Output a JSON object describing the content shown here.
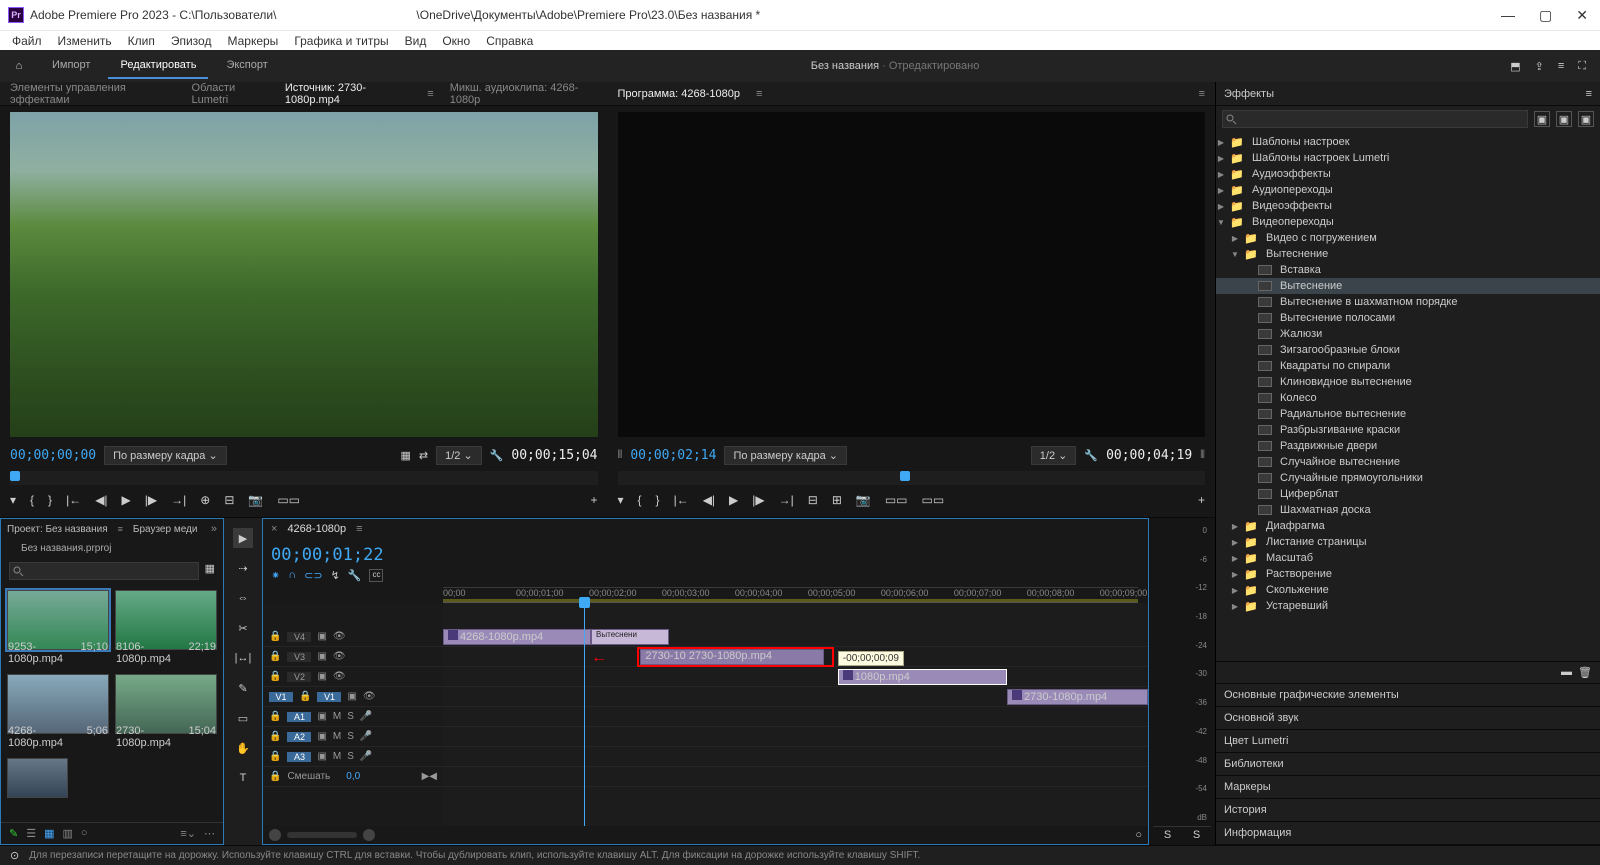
{
  "titlebar": {
    "app": "Adobe Premiere Pro 2023 - C:\\Пользователи\\",
    "path": "\\OneDrive\\Документы\\Adobe\\Premiere Pro\\23.0\\Без названия *"
  },
  "menubar": [
    "Файл",
    "Изменить",
    "Клип",
    "Эпизод",
    "Маркеры",
    "Графика и титры",
    "Вид",
    "Окно",
    "Справка"
  ],
  "header": {
    "workspaces": [
      "Импорт",
      "Редактировать",
      "Экспорт"
    ],
    "activeWs": 1,
    "docTitle": "Без названия",
    "docModified": "· Отредактировано"
  },
  "sourceTabs": {
    "items": [
      "Элементы управления эффектами",
      "Области Lumetri",
      "Источник: 2730-1080p.mp4",
      "Микш. аудиоклипа: 4268-1080p"
    ],
    "active": 2
  },
  "programTab": "Программа: 4268-1080p",
  "sourceMonitor": {
    "tcLeft": "00;00;00;00",
    "fit": "По размеру кадра",
    "res": "1/2",
    "tcRight": "00;00;15;04"
  },
  "programMonitor": {
    "tcLeft": "00;00;02;14",
    "fit": "По размеру кадра",
    "res": "1/2",
    "tcRight": "00;00;04;19"
  },
  "project": {
    "tab1": "Проект: Без названия",
    "tab2": "Браузер меди",
    "file": "Без названия.prproj",
    "clips": [
      {
        "name": "9253-1080p.mp4",
        "dur": "15;10"
      },
      {
        "name": "8106-1080p.mp4",
        "dur": "22;19"
      },
      {
        "name": "4268-1080p.mp4",
        "dur": "5;06"
      },
      {
        "name": "2730-1080p.mp4",
        "dur": "15;04"
      },
      {
        "name": "",
        "dur": ""
      }
    ]
  },
  "timeline": {
    "seq": "4268-1080p",
    "tc": "00;00;01;22",
    "ruler": [
      "00;00",
      "00;00;01;00",
      "00;00;02;00",
      "00;00;03;00",
      "00;00;04;00",
      "00;00;05;00",
      "00;00;06;00",
      "00;00;07;00",
      "00;00;08;00",
      "00;00;09;00"
    ],
    "tracks": {
      "v": [
        "V4",
        "V3",
        "V2",
        "V1"
      ],
      "a": [
        "A1",
        "A2",
        "A3"
      ],
      "mix": "Смешать",
      "mixVal": "0,0"
    },
    "clips": {
      "v4": "4268-1080p.mp4",
      "v4_trans": "Вытеснени",
      "v3": "2730-10    2730-1080p.mp4",
      "v2": "1080p.mp4",
      "v1": "2730-1080p.mp4",
      "tooltip": "-00;00;00;09"
    }
  },
  "meterLabels": [
    "0",
    "-6",
    "-12",
    "-18",
    "-24",
    "-30",
    "-36",
    "-42",
    "-48",
    "-54",
    "dB"
  ],
  "effects": {
    "title": "Эффекты",
    "searchPlaceholder": "",
    "tree": [
      {
        "t": "folder",
        "l": "Шаблоны настроек",
        "ind": 0,
        "exp": false
      },
      {
        "t": "folder",
        "l": "Шаблоны настроек Lumetri",
        "ind": 0,
        "exp": false
      },
      {
        "t": "folder",
        "l": "Аудиоэффекты",
        "ind": 0,
        "exp": false
      },
      {
        "t": "folder",
        "l": "Аудиопереходы",
        "ind": 0,
        "exp": false
      },
      {
        "t": "folder",
        "l": "Видеоэффекты",
        "ind": 0,
        "exp": false
      },
      {
        "t": "folder",
        "l": "Видеопереходы",
        "ind": 0,
        "exp": true
      },
      {
        "t": "folder",
        "l": "Видео с погружением",
        "ind": 1,
        "exp": false
      },
      {
        "t": "folder",
        "l": "Вытеснение",
        "ind": 1,
        "exp": true
      },
      {
        "t": "leaf",
        "l": "Вставка",
        "ind": 2
      },
      {
        "t": "leaf",
        "l": "Вытеснение",
        "ind": 2,
        "sel": true
      },
      {
        "t": "leaf",
        "l": "Вытеснение в шахматном порядке",
        "ind": 2
      },
      {
        "t": "leaf",
        "l": "Вытеснение полосами",
        "ind": 2
      },
      {
        "t": "leaf",
        "l": "Жалюзи",
        "ind": 2
      },
      {
        "t": "leaf",
        "l": "Зигзагообразные блоки",
        "ind": 2
      },
      {
        "t": "leaf",
        "l": "Квадраты по спирали",
        "ind": 2
      },
      {
        "t": "leaf",
        "l": "Клиновидное вытеснение",
        "ind": 2
      },
      {
        "t": "leaf",
        "l": "Колесо",
        "ind": 2
      },
      {
        "t": "leaf",
        "l": "Радиальное вытеснение",
        "ind": 2
      },
      {
        "t": "leaf",
        "l": "Разбрызгивание краски",
        "ind": 2
      },
      {
        "t": "leaf",
        "l": "Раздвижные двери",
        "ind": 2
      },
      {
        "t": "leaf",
        "l": "Случайное вытеснение",
        "ind": 2
      },
      {
        "t": "leaf",
        "l": "Случайные прямоугольники",
        "ind": 2
      },
      {
        "t": "leaf",
        "l": "Циферблат",
        "ind": 2
      },
      {
        "t": "leaf",
        "l": "Шахматная доска",
        "ind": 2
      },
      {
        "t": "folder",
        "l": "Диафрагма",
        "ind": 1,
        "exp": false
      },
      {
        "t": "folder",
        "l": "Листание страницы",
        "ind": 1,
        "exp": false
      },
      {
        "t": "folder",
        "l": "Масштаб",
        "ind": 1,
        "exp": false
      },
      {
        "t": "folder",
        "l": "Растворение",
        "ind": 1,
        "exp": false
      },
      {
        "t": "folder",
        "l": "Скольжение",
        "ind": 1,
        "exp": false
      },
      {
        "t": "folder",
        "l": "Устаревший",
        "ind": 1,
        "exp": false
      }
    ]
  },
  "sidePanels": [
    "Основные графические элементы",
    "Основной звук",
    "Цвет Lumetri",
    "Библиотеки",
    "Маркеры",
    "История",
    "Информация"
  ],
  "statusHint": "Для перезаписи перетащите на дорожку. Используйте клавишу CTRL для вставки. Чтобы дублировать клип, используйте клавишу ALT. Для фиксации на дорожке используйте клавишу SHIFT."
}
